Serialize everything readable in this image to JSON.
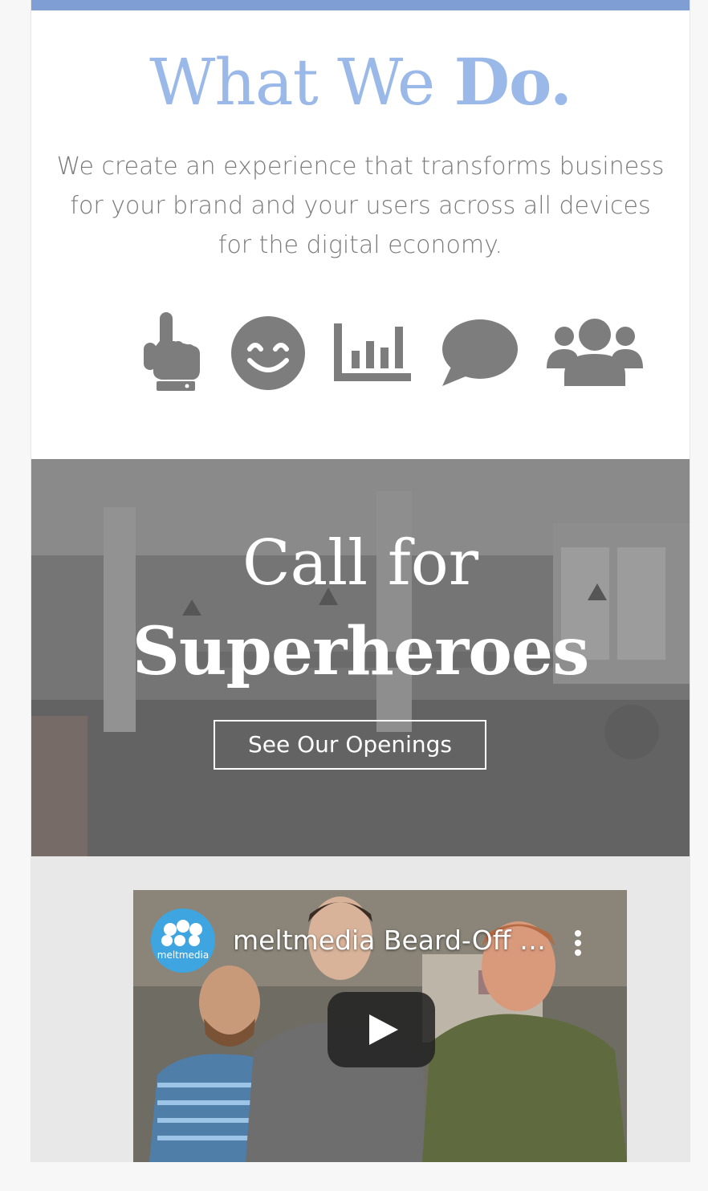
{
  "what_we_do": {
    "title_regular": "What We ",
    "title_bold": "Do.",
    "intro": "We create an experience that transforms business for your brand and your users across all devices for the digital economy.",
    "icons": [
      "pointing-hand-icon",
      "smile-icon",
      "bar-chart-icon",
      "chat-bubble-icon",
      "users-group-icon"
    ]
  },
  "hero": {
    "title_line1": "Call for",
    "title_line2": "Superheroes",
    "button_label": "See Our Openings"
  },
  "video": {
    "channel_name": "meltmedia",
    "title": "meltmedia Beard-Off C..."
  },
  "colors": {
    "accent": "#9bb9e8",
    "top_bar": "#7f9fd4",
    "icon_gray": "#7d7d7d",
    "channel_blue": "#3ea5e0"
  }
}
